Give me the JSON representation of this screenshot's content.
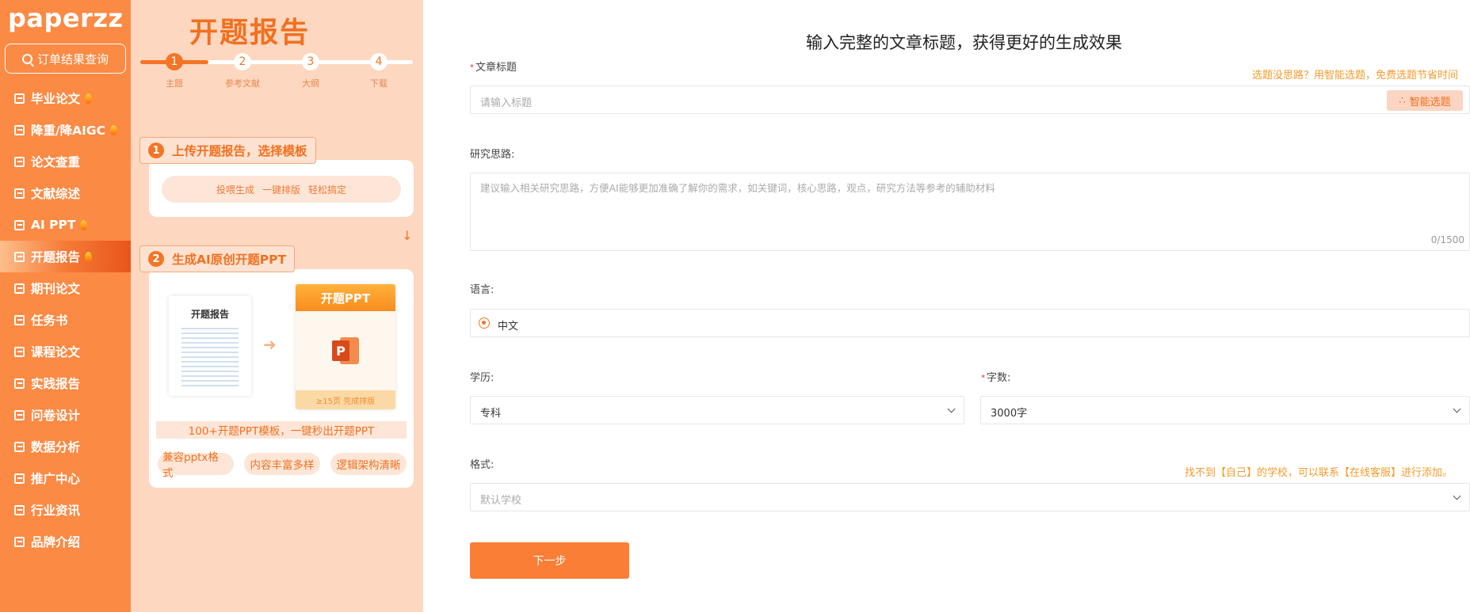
{
  "sidebar": {
    "logo": "paperzz",
    "order_search": "订单结果查询",
    "items": [
      {
        "label": "毕业论文",
        "hot": true
      },
      {
        "label": "降重/降AIGC",
        "hot": true
      },
      {
        "label": "论文查重",
        "hot": false
      },
      {
        "label": "文献综述",
        "hot": false
      },
      {
        "label": "AI PPT",
        "hot": true
      },
      {
        "label": "开题报告",
        "hot": true,
        "active": true
      },
      {
        "label": "期刊论文",
        "hot": false
      },
      {
        "label": "任务书",
        "hot": false
      },
      {
        "label": "课程论文",
        "hot": false
      },
      {
        "label": "实践报告",
        "hot": false
      },
      {
        "label": "问卷设计",
        "hot": false
      },
      {
        "label": "数据分析",
        "hot": false
      },
      {
        "label": "推广中心",
        "hot": false
      },
      {
        "label": "行业资讯",
        "hot": false
      },
      {
        "label": "品牌介绍",
        "hot": false
      }
    ]
  },
  "promo": {
    "title": "开题报告",
    "steps": [
      {
        "num": "1",
        "label": "主题"
      },
      {
        "num": "2",
        "label": "参考文献"
      },
      {
        "num": "3",
        "label": "大纲"
      },
      {
        "num": "4",
        "label": "下载"
      }
    ],
    "section1": {
      "num": "1",
      "title": "上传开题报告，选择模板",
      "pill": [
        "投喂生成",
        "一键排版",
        "轻松搞定"
      ]
    },
    "section2": {
      "num": "2",
      "title": "生成AI原创开题PPT",
      "doc_title": "开题报告",
      "ppt_title": "开题PPT",
      "ppt_footer": "≥15页 完成排版",
      "banner": "100+开题PPT模板，一键秒出开题PPT",
      "chips": [
        "兼容pptx格式",
        "内容丰富多样",
        "逻辑架构清晰"
      ]
    }
  },
  "form": {
    "heading": "输入完整的文章标题，获得更好的生成效果",
    "title_field": {
      "label": "文章标题",
      "required": true,
      "placeholder": "请输入标题",
      "hint": "选题没思路？用智能选题，免费选题节省时间",
      "smart_button": "智能选题"
    },
    "idea_field": {
      "label": "研究思路:",
      "placeholder": "建议输入相关研究思路，方便AI能够更加准确了解你的需求，如关键词，核心思路，观点，研究方法等参考的辅助材料",
      "counter": "0/1500"
    },
    "language_field": {
      "label": "语言:",
      "value": "中文"
    },
    "degree_field": {
      "label": "学历:",
      "value": "专科"
    },
    "words_field": {
      "label": "字数:",
      "required": true,
      "value": "3000字"
    },
    "format_field": {
      "label": "格式:",
      "placeholder": "默认学校",
      "hint": "找不到【自己】的学校，可以联系【在线客服】进行添加。"
    },
    "next_button": "下一步"
  }
}
